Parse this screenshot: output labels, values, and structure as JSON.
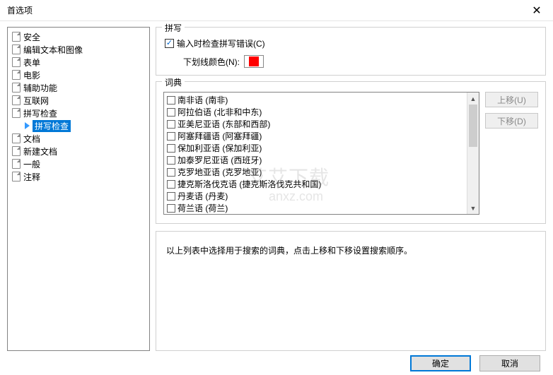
{
  "window": {
    "title": "首选项"
  },
  "sidebar": {
    "items": [
      {
        "label": "安全"
      },
      {
        "label": "编辑文本和图像"
      },
      {
        "label": "表单"
      },
      {
        "label": "电影"
      },
      {
        "label": "辅助功能"
      },
      {
        "label": "互联网"
      },
      {
        "label": "拼写检查"
      },
      {
        "label": "拼写检查",
        "child": true,
        "selected": true
      },
      {
        "label": "文档"
      },
      {
        "label": "新建文档"
      },
      {
        "label": "一般"
      },
      {
        "label": "注释"
      }
    ]
  },
  "spelling": {
    "group_title": "拼写",
    "check_label": "输入时检查拼写错误(C)",
    "color_label": "下划线颜色(N):",
    "color_value": "#ff0000"
  },
  "dictionary": {
    "group_title": "词典",
    "items": [
      "南非语 (南非)",
      "阿拉伯语 (北非和中东)",
      "亚美尼亚语 (东部和西部)",
      "阿塞拜疆语 (阿塞拜疆)",
      "保加利亚语 (保加利亚)",
      "加泰罗尼亚语 (西班牙)",
      "克罗地亚语 (克罗地亚)",
      "捷克斯洛伐克语 (捷克斯洛伐克共和国)",
      "丹麦语 (丹麦)",
      "荷兰语 (荷兰)"
    ],
    "move_up": "上移(U)",
    "move_down": "下移(D)"
  },
  "info": {
    "text": "以上列表中选择用于搜索的词典，点击上移和下移设置搜索顺序。"
  },
  "footer": {
    "ok": "确定",
    "cancel": "取消"
  },
  "watermark": {
    "line1": "艾艾下载",
    "line2": "anxz.com"
  }
}
